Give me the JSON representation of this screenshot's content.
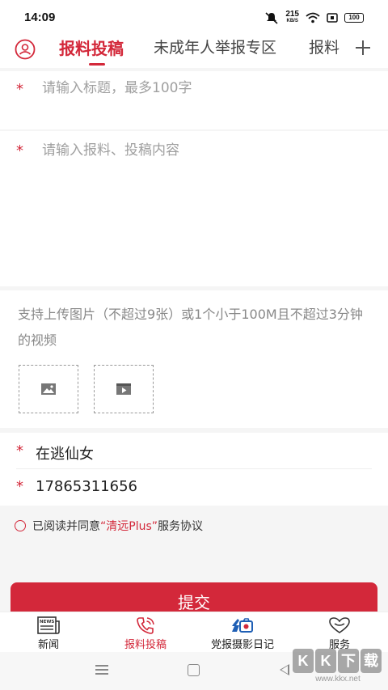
{
  "status_bar": {
    "time": "14:09",
    "net_speed_value": "215",
    "net_speed_unit": "KB/S",
    "battery": "100"
  },
  "tabs": [
    {
      "label": "报料投稿",
      "active": true
    },
    {
      "label": "未成年人举报专区",
      "active": false
    },
    {
      "label": "报料",
      "active": false
    }
  ],
  "form": {
    "title_placeholder": "请输入标题，最多100字",
    "content_placeholder": "请输入报料、投稿内容",
    "upload_tip": "支持上传图片（不超过9张）或1个小于100M且不超过3分钟的视频",
    "name_value": "在逃仙女",
    "phone_value": "17865311656",
    "required_mark": "*"
  },
  "agreement": {
    "prefix": "已阅读并同意",
    "link_text": "“清远Plus”",
    "suffix": "服务协议"
  },
  "submit_label": "提交",
  "bottom_nav": [
    {
      "label": "新闻",
      "icon": "news-icon",
      "active": false
    },
    {
      "label": "报料投稿",
      "icon": "report-phone-icon",
      "active": true
    },
    {
      "label": "党报摄影日记",
      "icon": "photo-diary-icon",
      "active": false
    },
    {
      "label": "服务",
      "icon": "heart-service-icon",
      "active": false
    }
  ],
  "watermark": {
    "badges": [
      "K",
      "K",
      "下",
      "载"
    ],
    "url": "www.kkx.net"
  },
  "colors": {
    "accent": "#d3283a"
  }
}
